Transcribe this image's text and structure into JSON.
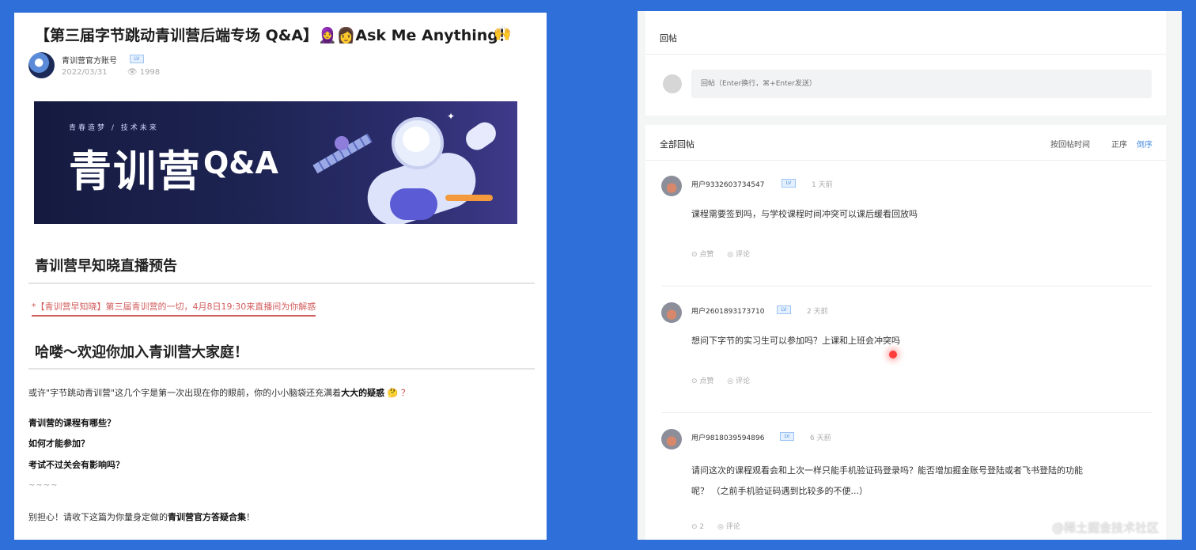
{
  "article": {
    "title": "【第三届字节跳动青训营后端专场 Q&A】",
    "title_emoji": "🧕👩",
    "title_tail": "Ask Me Anything！",
    "hands_emoji": "🙌",
    "author": "青训营官方账号",
    "author_badge": "LV",
    "date": "2022/03/31",
    "views": "👁 1998",
    "banner": {
      "slogan": "青春造梦 / 技术未来",
      "big_text": "青训营",
      "qa_text": "Q&A"
    },
    "section1_title": "青训营早知晓直播预告",
    "section1_link": "*【青训营早知晓】第三届青训营的一切，4月8日19:30来直播间为你解惑",
    "section2_title": "哈喽～欢迎你加入青训营大家庭！",
    "intro_prefix": "或许\"字节跳动青训营\"这几个字是第一次出现在你的眼前，你的小小脑袋还充满着",
    "intro_bold": "大大的疑惑",
    "intro_emoji": "🤔",
    "intro_mark": "？",
    "questions": [
      "青训营的课程有哪些？",
      "如何才能参加？",
      "考试不过关会有影响吗？"
    ],
    "dash": "~~~~",
    "footer_prefix": "别担心！请收下这篇为你量身定做的",
    "footer_bold": "青训营官方答疑合集",
    "footer_suffix": "！"
  },
  "reply": {
    "title": "回帖",
    "placeholder": "回帖（Enter换行，⌘+Enter发送）"
  },
  "all_replies": {
    "title": "全部回帖",
    "sort_label": "按回帖时间",
    "sort_asc": "正序",
    "sort_desc": "倒序",
    "colors": {
      "active": "#4d8fe0",
      "inactive": "#555555"
    }
  },
  "comments": [
    {
      "user": "用户9332603734547",
      "badge": "LV",
      "time": "1 天前",
      "text": "课程需要签到吗，与学校课程时间冲突可以课后缓看回放吗",
      "like": "⊙ 点赞",
      "comment": "◎ 评论"
    },
    {
      "user": "用户2601893173710",
      "badge": "LV",
      "time": "2 天前",
      "text": "想问下字节的实习生可以参加吗？上课和上班会冲突吗",
      "like": "⊙ 点赞",
      "comment": "◎ 评论"
    },
    {
      "user": "用户9818039594896",
      "badge": "LV",
      "time": "6 天前",
      "text_line1": "请问这次的课程观看会和上次一样只能手机验证码登录吗？能否增加掘金账号登陆或者飞书登陆的功能",
      "text_line2": "呢？ （之前手机验证码遇到比较多的不便...）",
      "like": "⊙ 2",
      "comment": "◎ 评论"
    }
  ],
  "watermark": "@稀土掘金技术社区"
}
